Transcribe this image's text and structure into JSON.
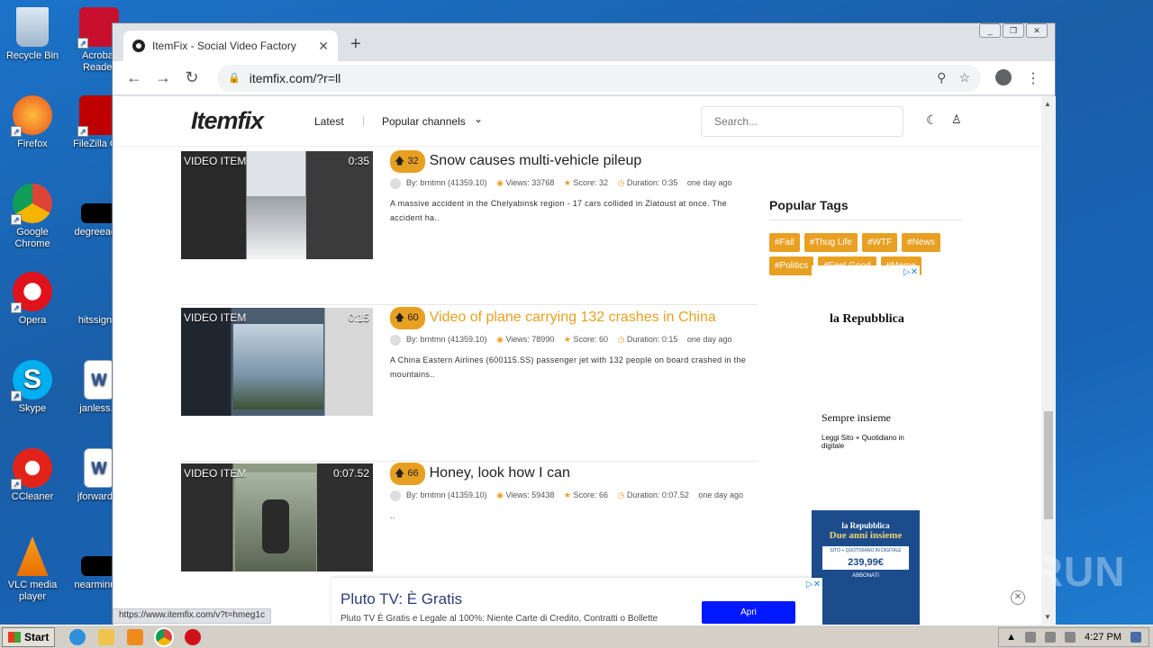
{
  "desktop": {
    "icons": [
      {
        "label": "Recycle Bin"
      },
      {
        "label": "Acrobat Reader"
      },
      {
        "label": "Firefox"
      },
      {
        "label": "FileZilla C..."
      },
      {
        "label": "Google Chrome"
      },
      {
        "label": "degreeac..."
      },
      {
        "label": "Opera"
      },
      {
        "label": "hitssign..."
      },
      {
        "label": "Skype"
      },
      {
        "label": "janless..."
      },
      {
        "label": "CCleaner"
      },
      {
        "label": "jforward..."
      },
      {
        "label": "VLC media player"
      },
      {
        "label": "nearminu..."
      }
    ],
    "watermark": "ANY.RUN"
  },
  "browser": {
    "tab_title": "ItemFix - Social Video Factory",
    "tab_close": "✕",
    "new_tab": "+",
    "url": "itemfix.com/?r=ll",
    "status_url": "https://www.itemfix.com/v?t=hmeg1c"
  },
  "site": {
    "logo": "Itemfix",
    "nav": {
      "latest": "Latest",
      "popular": "Popular channels"
    },
    "search_placeholder": "Search..."
  },
  "videos": [
    {
      "label": "VIDEO ITEM",
      "duration": "0:35",
      "score": "32",
      "title": "Snow causes multi-vehicle pileup",
      "by": "By: brntmn (41359.10)",
      "views": "Views: 33768",
      "score_text": "Score: 32",
      "duration_text": "Duration: 0:35",
      "age": "one day ago",
      "desc": "A massive accident in the Chelyabinsk region - 17 cars collided in Zlatoust at once. The accident ha.."
    },
    {
      "label": "VIDEO ITEM",
      "duration": "0:15",
      "score": "60",
      "title": "Video of plane carrying 132 crashes in China",
      "by": "By: brntmn (41359.10)",
      "views": "Views: 78990",
      "score_text": "Score: 60",
      "duration_text": "Duration: 0:15",
      "age": "one day ago",
      "desc": "A China Eastern Airlines (600115.SS) passenger jet with 132 people on board crashed in the mountains.."
    },
    {
      "label": "VIDEO ITEM",
      "duration": "0:07.52",
      "score": "66",
      "title": "Honey, look how I can",
      "by": "By: brntmn (41359.10)",
      "views": "Views: 59438",
      "score_text": "Score: 66",
      "duration_text": "Duration: 0:07.52",
      "age": "one day ago",
      "desc": ".."
    }
  ],
  "popular_tags": {
    "title": "Popular Tags",
    "tags": [
      "#Fail",
      "#Thug Life",
      "#WTF",
      "#News",
      "#Politics",
      "#Feel Good",
      "#Meme"
    ]
  },
  "ad_side": {
    "brand": "la Repubblica",
    "tagline": "Sempre insieme",
    "sub": "Leggi Sito + Quotidiano in digitale",
    "banner_brand": "la Repubblica",
    "banner_title": "Due anni insieme",
    "banner_offer": "SITO + QUOTIDIANO IN DIGITALE",
    "banner_price": "239,99€",
    "banner_cta": "ABBONATI"
  },
  "ad_bottom": {
    "headline": "Pluto TV: È Gratis",
    "body": "Pluto TV È Gratis e Legale al 100%: Niente Carte di Credito, Contratti o Bollette Pluto.tv",
    "cta": "Apri"
  },
  "taskbar": {
    "start": "Start",
    "time": "4:27 PM"
  }
}
